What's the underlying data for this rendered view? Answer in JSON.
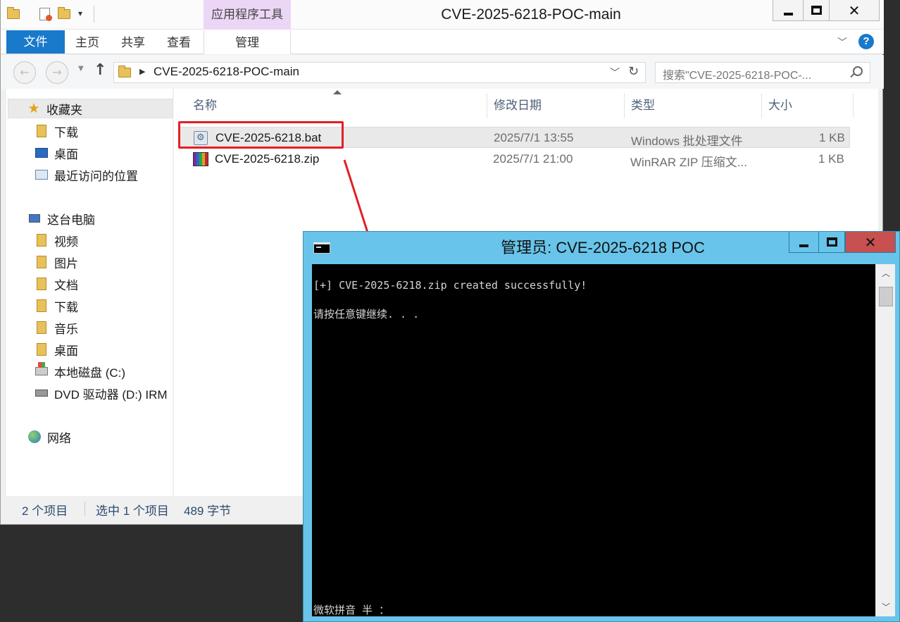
{
  "explorer": {
    "window_title": "CVE-2025-6218-POC-main",
    "context_tab_group": "应用程序工具",
    "ribbon_tabs": [
      "文件",
      "主页",
      "共享",
      "查看",
      "管理"
    ],
    "address_path": "CVE-2025-6218-POC-main",
    "search_placeholder": "搜索\"CVE-2025-6218-POC-...",
    "nav_pane": {
      "favorites": "收藏夹",
      "favorite_items": [
        "下载",
        "桌面",
        "最近访问的位置"
      ],
      "this_pc": "这台电脑",
      "pc_items": [
        "视频",
        "图片",
        "文档",
        "下载",
        "音乐",
        "桌面",
        "本地磁盘 (C:)",
        "DVD 驱动器 (D:) IRM"
      ],
      "network": "网络"
    },
    "columns": [
      "名称",
      "修改日期",
      "类型",
      "大小"
    ],
    "files": [
      {
        "name": "CVE-2025-6218.bat",
        "modified": "2025/7/1 13:55",
        "type": "Windows 批处理文件",
        "size": "1 KB",
        "selected": true
      },
      {
        "name": "CVE-2025-6218.zip",
        "modified": "2025/7/1 21:00",
        "type": "WinRAR ZIP 压缩文...",
        "size": "1 KB",
        "selected": false
      }
    ],
    "status": {
      "item_count": "2 个项目",
      "selection": "选中 1 个项目",
      "size": "489 字节"
    }
  },
  "console": {
    "title": "管理员:  CVE-2025-6218 POC",
    "lines": [
      "[+] CVE-2025-6218.zip created successfully!",
      "请按任意键继续. . .",
      "微软拼音 半 ："
    ]
  },
  "annotation": {
    "highlight_color": "#e41e26"
  }
}
